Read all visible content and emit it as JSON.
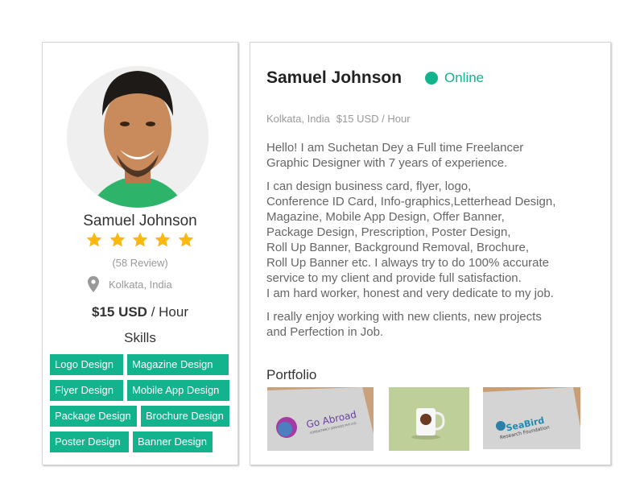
{
  "profile": {
    "name": "Samuel Johnson",
    "rating": 5,
    "rating_max": 5,
    "reviews": "(58 Review)",
    "location": "Kolkata, India",
    "rate_amount": "$15 USD",
    "rate_unit": " / Hour",
    "rate_full": "$15 USD / Hour",
    "status": "Online",
    "skills_title": "Skills",
    "skills": [
      "Logo Design",
      "Magazine Design",
      "Flyer Design",
      "Mobile App Design",
      "Package Design",
      "Brochure Design",
      "Poster Design",
      "Banner Design"
    ]
  },
  "bio": {
    "p1": "Hello! I am Suchetan Dey a Full time Freelancer\nGraphic Designer with 7 years of experience.",
    "p2": "I can design business card, flyer, logo,\nConference ID Card, Info-graphics,Letterhead Design,\nMagazine, Mobile App Design, Offer Banner,\nPackage Design, Prescription, Poster Design,\nRoll Up Banner, Background Removal, Brochure,\nRoll Up Banner etc. I always try to do 100% accurate\nservice to my client and provide full satisfaction.\nI am hard worker, honest and very dedicate to my job.",
    "p3": "I really enjoy working with new clients, new projects\nand Perfection in Job."
  },
  "portfolio": {
    "title": "Portfolio",
    "items": [
      {
        "brand": "Go Abroad",
        "tagline": "CONSULTANCY SERVICES PVT LTD."
      },
      {
        "brand": "Coffee mug logo mockup",
        "tagline": ""
      },
      {
        "brand": "SeaBird",
        "tagline": "Research Foundation"
      }
    ]
  },
  "colors": {
    "accent": "#13b38e",
    "star": "#fbb80f",
    "muted_text": "#999999"
  }
}
